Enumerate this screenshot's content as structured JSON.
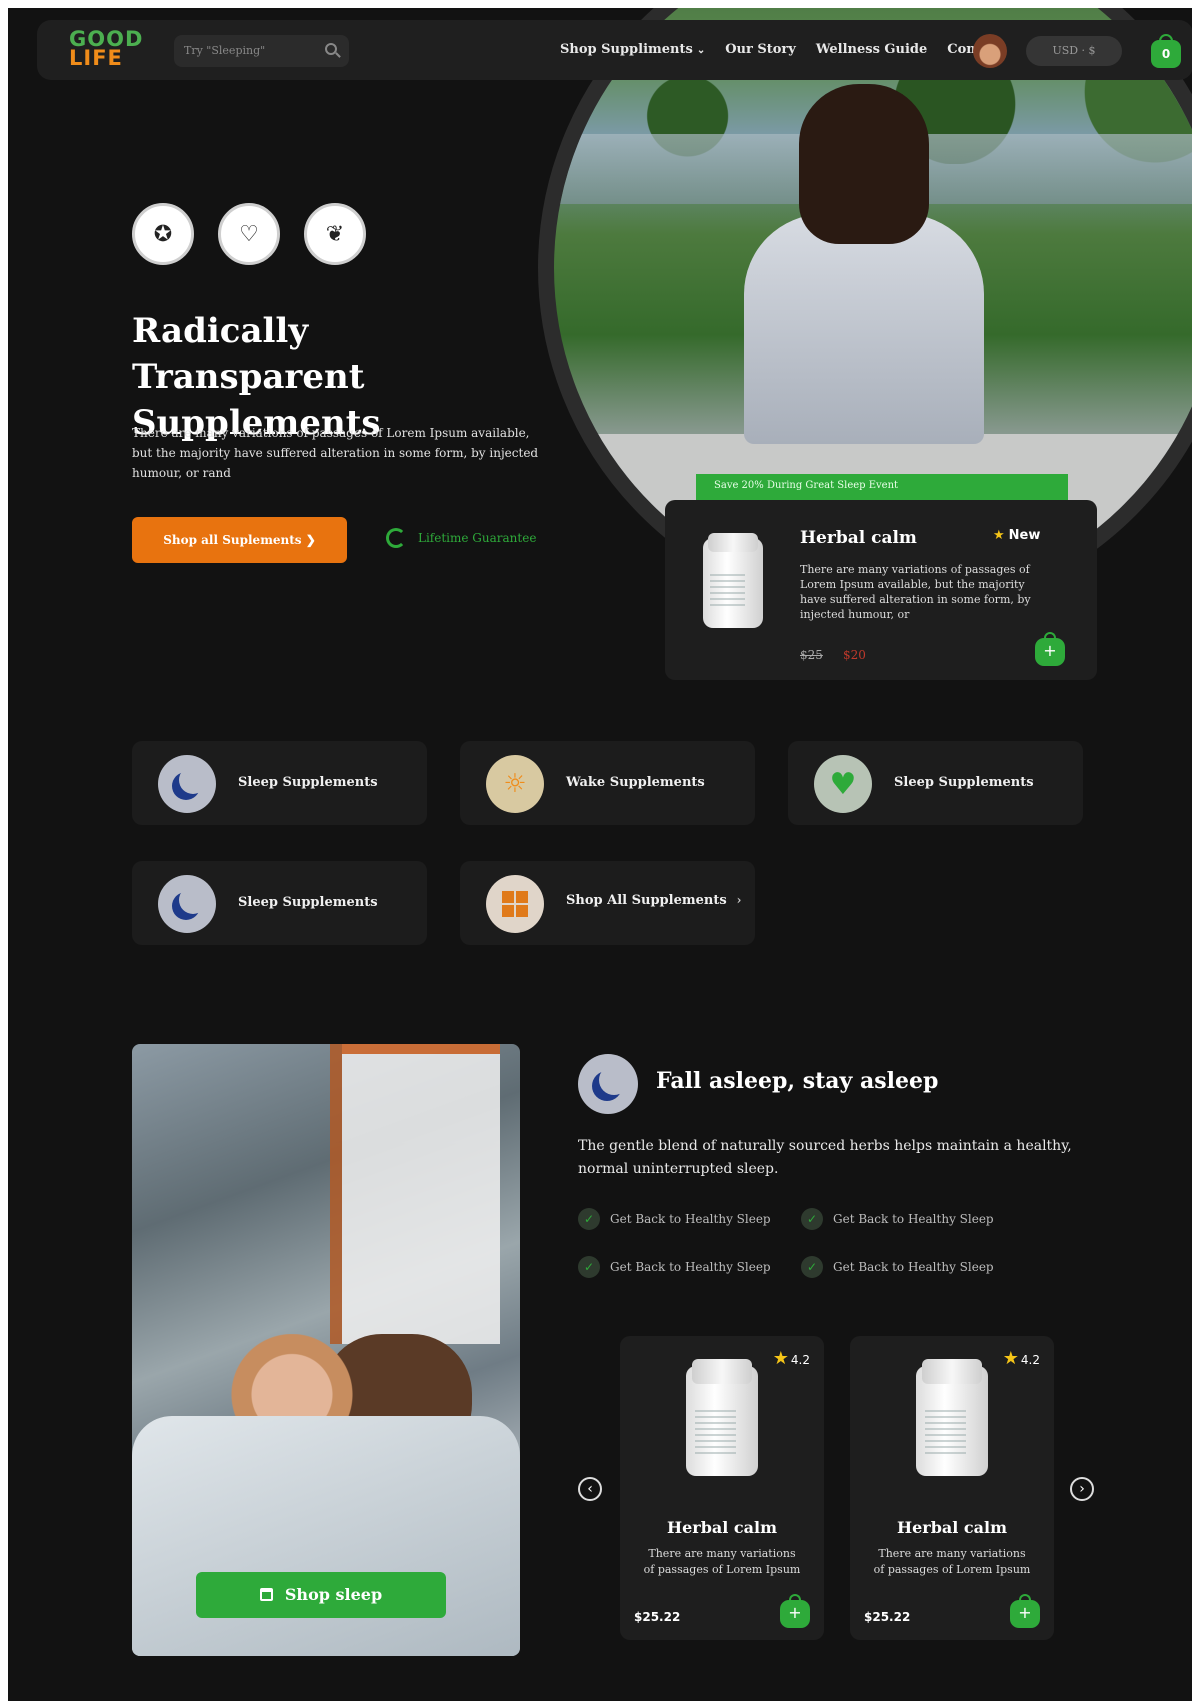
{
  "nav": {
    "logo_line1": "GOOD",
    "logo_line2": "LIFE",
    "search_placeholder": "Try \"Sleeping\"",
    "links": [
      "Shop Suppliments",
      "Our Story",
      "Wellness Guide",
      "Contact"
    ],
    "currency": "USD · $",
    "cart_count": "0"
  },
  "hero": {
    "title": "Radically Transparent Supplements",
    "text": "There are many variations of passages of Lorem Ipsum available, but the majority have suffered alteration in some form, by injected humour, or rand",
    "cta": "Shop all Suplements ❯",
    "guarantee": "Lifetime Guarantee",
    "badges": [
      "certified-quality-icon",
      "heart-lab-icon",
      "leaf-vegan-icon"
    ]
  },
  "promo": {
    "bar": "Save 20% During Great Sleep Event",
    "title": "Herbal calm",
    "badge": "New",
    "text": "There are many variations of passages of Lorem Ipsum available, but the majority have suffered alteration in some form, by injected humour, or",
    "old_price": "$25",
    "new_price": "$20"
  },
  "categories": [
    {
      "label": "Sleep Supplements",
      "icon": "moon-icon"
    },
    {
      "label": "Wake Supplements",
      "icon": "sun-icon"
    },
    {
      "label": "Sleep Supplements",
      "icon": "heart-icon"
    },
    {
      "label": "Sleep Supplements",
      "icon": "moon-icon"
    },
    {
      "label": "Shop All Supplements",
      "icon": "grid-icon"
    }
  ],
  "sleep": {
    "cta": "Shop sleep",
    "title": "Fall asleep, stay asleep",
    "text": "The gentle blend of naturally sourced herbs helps maintain a healthy, normal uninterrupted sleep.",
    "benefits": [
      "Get Back to Healthy Sleep",
      "Get Back to Healthy Sleep",
      "Get Back to Healthy Sleep",
      "Get Back to Healthy Sleep"
    ],
    "products": [
      {
        "title": "Herbal calm",
        "text": "There are many variations of passages of Lorem Ipsum",
        "price": "$25.22",
        "rating": "4.2"
      },
      {
        "title": "Herbal calm",
        "text": "There are many variations of passages of Lorem Ipsum",
        "price": "$25.22",
        "rating": "4.2"
      }
    ]
  },
  "colors": {
    "background": "#121212",
    "accent_green": "#2eaa3a",
    "accent_orange": "#e8730f"
  }
}
